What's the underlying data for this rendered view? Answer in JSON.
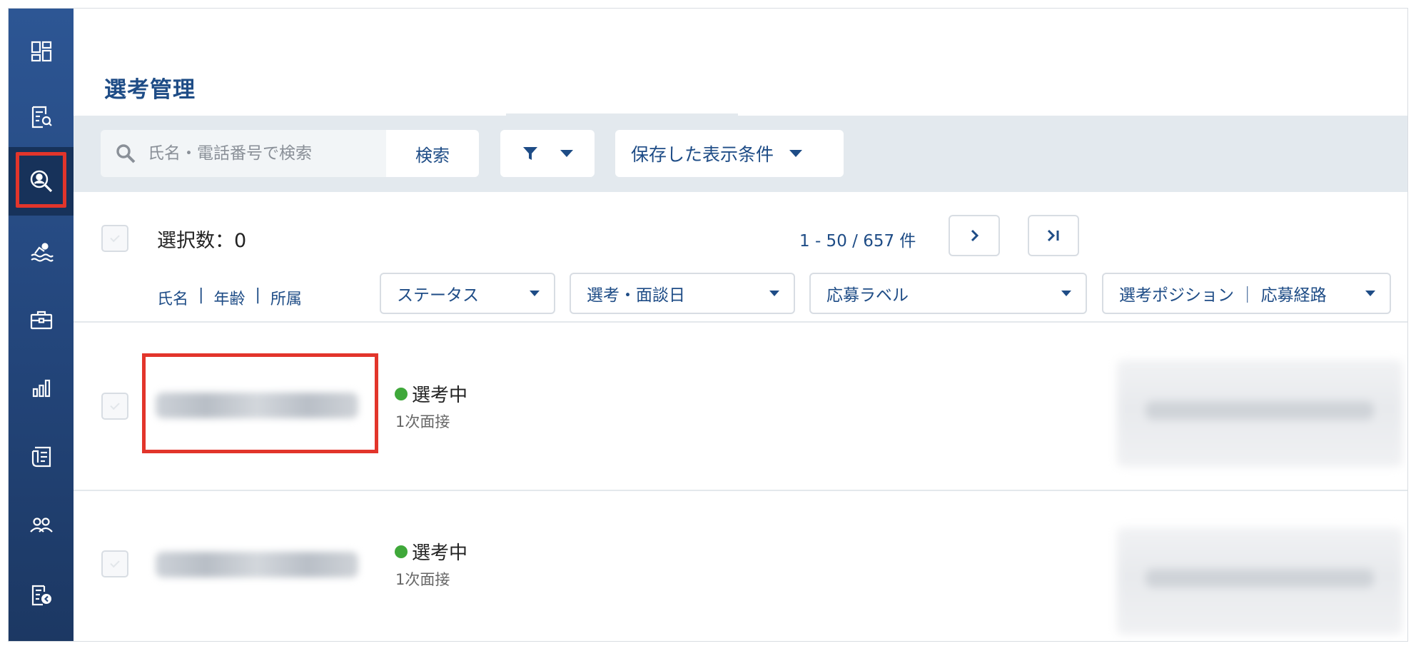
{
  "sidebar": {
    "items": [
      {
        "icon": "dashboard-icon"
      },
      {
        "icon": "document-search-icon"
      },
      {
        "icon": "candidate-search-icon",
        "active": true
      },
      {
        "icon": "swimmer-icon"
      },
      {
        "icon": "briefcase-icon"
      },
      {
        "icon": "bar-chart-icon"
      },
      {
        "icon": "documents-icon"
      },
      {
        "icon": "users-icon"
      },
      {
        "icon": "document-add-icon"
      }
    ],
    "active_outline_color": "#e2352b"
  },
  "page": {
    "title": "選考管理"
  },
  "search": {
    "placeholder": "氏名・電話番号で検索",
    "button_label": "検索"
  },
  "filter": {
    "icon": "filter-icon"
  },
  "saved_view": {
    "label": "保存した表示条件"
  },
  "selection": {
    "label": "選択数：0"
  },
  "pagination": {
    "range_text": "1 - 50 / 657 件",
    "next_label": ">",
    "last_label": ">|"
  },
  "columns": {
    "name": "氏名",
    "age": "年齢",
    "affiliation": "所属",
    "separator": "|",
    "status": "ステータス",
    "interview_date": "選考・面談日",
    "application_label": "応募ラベル",
    "position_route": "選考ポジション ｜ 応募経路"
  },
  "rows": [
    {
      "status": "選考中",
      "status_color": "#3fa83a",
      "stage": "1次面接"
    },
    {
      "status": "選考中",
      "status_color": "#3fa83a",
      "stage": "1次面接"
    }
  ],
  "colors": {
    "accent": "#1e4c86",
    "sidebar": "#2d5694",
    "toolbar_bg": "#e3e9ee",
    "highlight": "#e2352b"
  }
}
